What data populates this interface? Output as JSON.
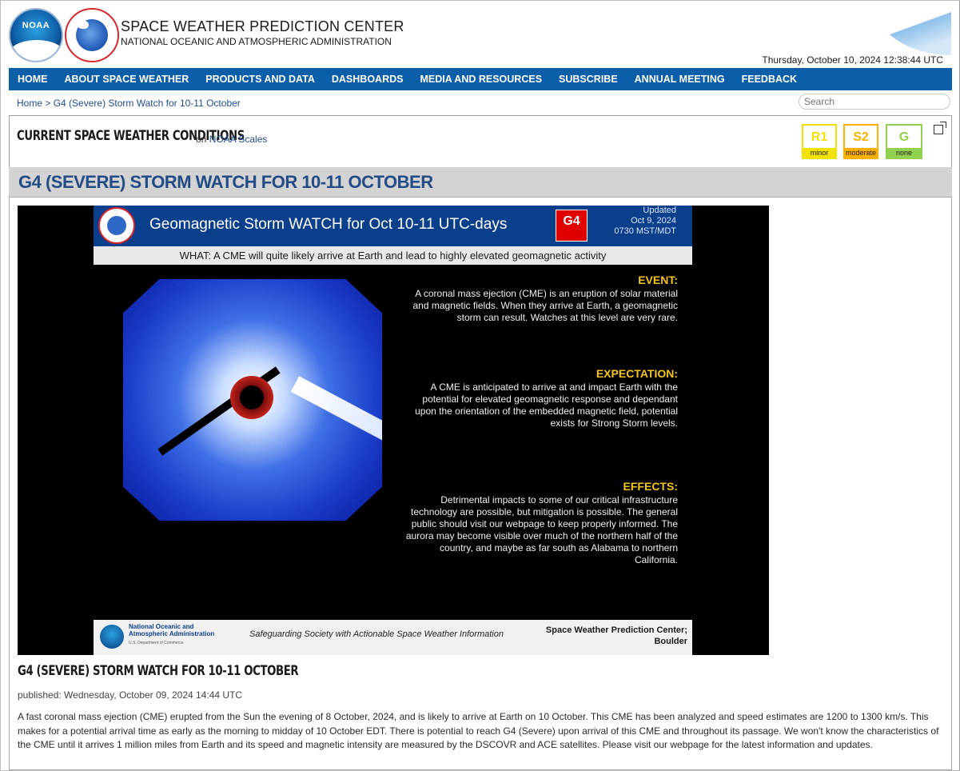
{
  "header": {
    "org_title": "SPACE WEATHER PREDICTION CENTER",
    "org_subtitle": "NATIONAL OCEANIC AND ATMOSPHERIC ADMINISTRATION",
    "noaa_logo_text": "NOAA",
    "datetime": "Thursday, October 10, 2024 12:38:44 UTC"
  },
  "nav": {
    "items": [
      {
        "label": "HOME"
      },
      {
        "label": "ABOUT SPACE WEATHER"
      },
      {
        "label": "PRODUCTS AND DATA"
      },
      {
        "label": "DASHBOARDS"
      },
      {
        "label": "MEDIA AND RESOURCES"
      },
      {
        "label": "SUBSCRIBE"
      },
      {
        "label": "ANNUAL MEETING"
      },
      {
        "label": "FEEDBACK"
      }
    ]
  },
  "breadcrumb": {
    "home": "Home",
    "sep": " > ",
    "current": "G4 (Severe) Storm Watch for 10-11 October"
  },
  "search": {
    "placeholder": "Search"
  },
  "conditions": {
    "title": "CURRENT SPACE WEATHER CONDITIONS",
    "on": "on",
    "scales_link": "NOAA Scales",
    "scales": [
      {
        "code": "R1",
        "level": "minor",
        "color": "#f2e200"
      },
      {
        "code": "S2",
        "level": "moderate",
        "color": "#ffb000"
      },
      {
        "code": "G",
        "level": "none",
        "color": "#92d050"
      }
    ]
  },
  "page": {
    "headline": "G4 (SEVERE) STORM WATCH FOR 10-11 OCTOBER"
  },
  "graphic": {
    "title": "Geomagnetic Storm WATCH for Oct 10-11 UTC-days",
    "badge": "G4",
    "updated_label": "Updated",
    "updated_date": "Oct 9, 2024",
    "updated_time": "0730 MST/MDT",
    "what": "WHAT: A CME will quite likely arrive at Earth and lead to highly elevated geomagnetic activity",
    "event_h": "EVENT:",
    "event_t": "A coronal mass ejection (CME) is an eruption of solar material and magnetic fields. When they arrive at Earth, a geomagnetic storm can result. Watches at this level are very rare.",
    "expect_h": "EXPECTATION:",
    "expect_t": "A CME is anticipated to arrive at and impact Earth with the potential for elevated geomagnetic response and dependant upon the orientation of the embedded magnetic field,  potential exists for Strong Storm levels.",
    "effects_h": "EFFECTS:",
    "effects_t": "Detrimental impacts to some of our critical infrastructure technology are possible, but  mitigation is possible. The general public should visit our webpage to keep properly informed. The aurora may become visible over much of the northern half of the country, and maybe as far south as Alabama to northern California.",
    "footer_org1": "National Oceanic and",
    "footer_org2": "Atmospheric Administration",
    "footer_dept": "U.S. Department of Commerce",
    "footer_tag": "Safeguarding Society with Actionable Space Weather Information",
    "footer_center1": "Space Weather Prediction Center;",
    "footer_center2": "Boulder"
  },
  "article": {
    "title": "G4 (SEVERE) STORM WATCH FOR 10-11 OCTOBER",
    "published": "published: Wednesday, October 09, 2024 14:44 UTC",
    "body": "A fast coronal mass ejection (CME) erupted from the Sun the evening of 8 October, 2024, and is likely to arrive at Earth on 10 October. This CME has been analyzed and speed estimates are 1200 to 1300 km/s. This makes for a potential arrival time as early as the morning to midday of 10 October EDT. There is potential to reach G4 (Severe) upon arrival of this CME and throughout its passage. We won't know the characteristics of the CME until it arrives 1 million miles from Earth and its speed and magnetic intensity are measured by the DSCOVR and ACE satellites. Please visit our webpage for the latest information and updates."
  }
}
